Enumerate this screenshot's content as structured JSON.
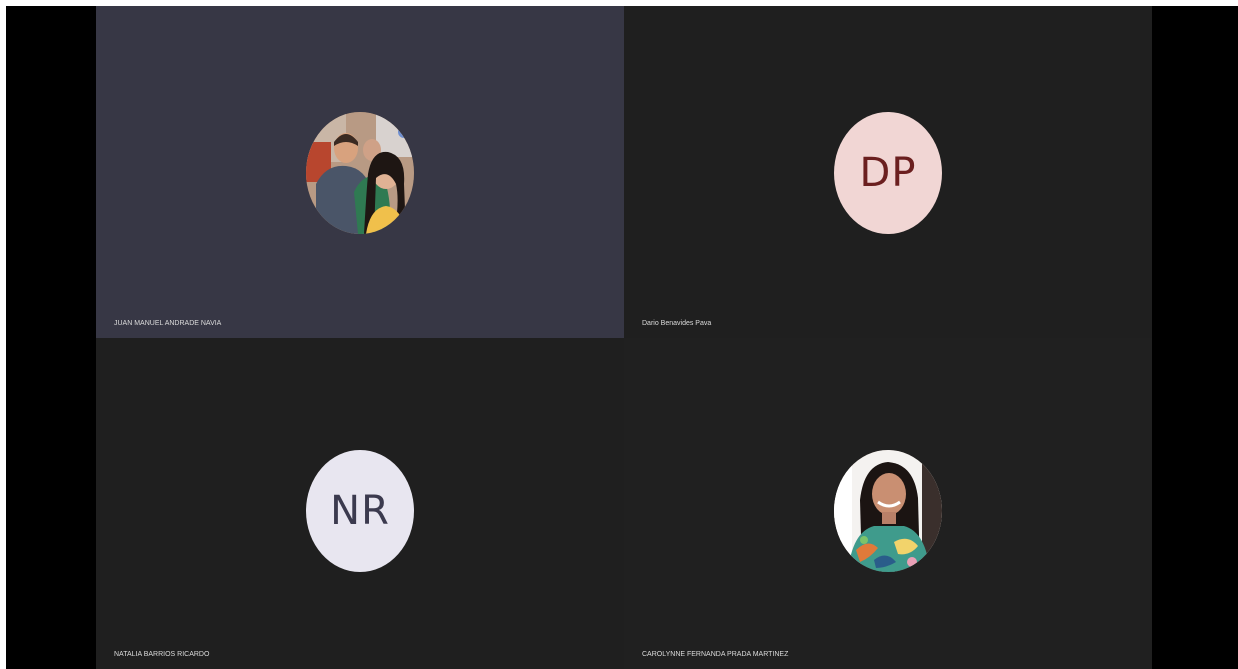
{
  "participants": [
    {
      "name": "JUAN MANUEL ANDRADE NAVIA",
      "avatar_type": "photo",
      "avatar_icon": "participant-photo"
    },
    {
      "name": "Dario Benavides Pava",
      "avatar_type": "initials",
      "initials": "DP",
      "avatar_color": "#f1d6d4",
      "initials_color": "#6b1f1f"
    },
    {
      "name": "NATALIA BARRIOS RICARDO",
      "avatar_type": "initials",
      "initials": "NR",
      "avatar_color": "#e8e6f0",
      "initials_color": "#3b3a4e"
    },
    {
      "name": "CAROLYNNE FERNANDA PRADA MARTINEZ",
      "avatar_type": "photo",
      "avatar_icon": "participant-photo"
    }
  ],
  "colors": {
    "active_tile": "#373745",
    "tile": "#1f1f1f",
    "background": "#000000"
  }
}
